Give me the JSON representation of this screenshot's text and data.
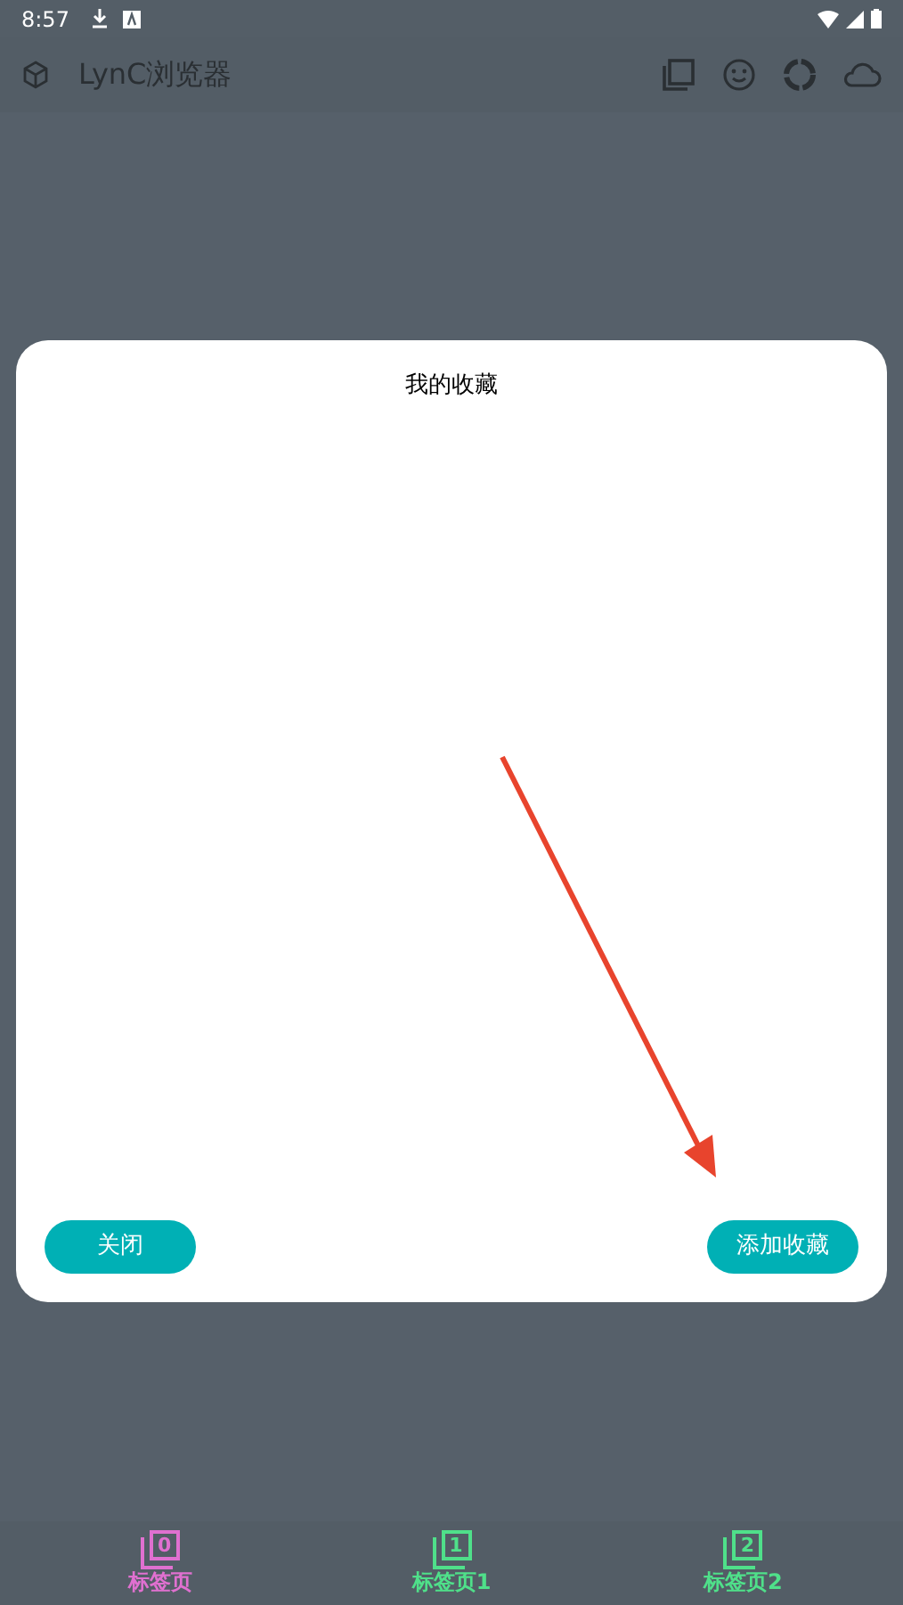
{
  "status_bar": {
    "time": "8:57"
  },
  "app_bar": {
    "title": "LynC浏览器"
  },
  "dialog": {
    "title": "我的收藏",
    "buttons": [
      {
        "label": "关闭"
      },
      {
        "label": "添加收藏"
      }
    ]
  },
  "bottom_tabs": [
    {
      "label": "标签页",
      "number": "0",
      "selected": true
    },
    {
      "label": "标签页1",
      "number": "1",
      "selected": false
    },
    {
      "label": "标签页2",
      "number": "2",
      "selected": false
    }
  ]
}
